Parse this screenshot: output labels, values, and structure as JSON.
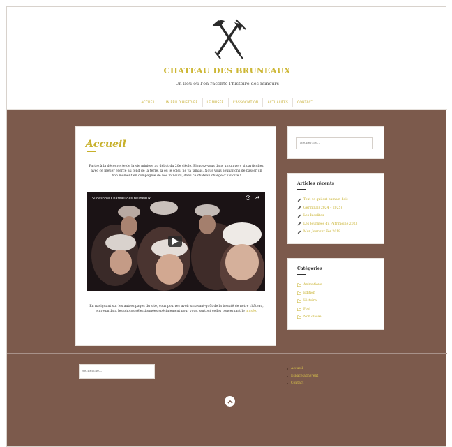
{
  "header": {
    "title": "CHATEAU DES BRUNEAUX",
    "tagline": "Un lieu où l'on raconte l'histoire des mineurs",
    "logo_icon": "crossed-shovel-pickaxe-icon"
  },
  "nav": {
    "items": [
      {
        "label": "ACCUEIL"
      },
      {
        "label": "UN PEU D'HISTOIRE"
      },
      {
        "label": "LE MUSÉE"
      },
      {
        "label": "L'ASSOCIATION"
      },
      {
        "label": "ACTUALITÉS"
      },
      {
        "label": "CONTACT"
      }
    ]
  },
  "main": {
    "page_title": "Accueil",
    "intro": "Partez à la découverte de la vie minière au début du 20e siècle. Plongez-vous dans un univers si particulier, avec ce métier exercé au fond de la terre, là où le soleil ne va jamais. Nous vous souhaitons de passer un bon moment en compagnie de nos mineurs, dans ce château chargé d'histoire !",
    "video_title": "Slideshow Château des Bruneaux",
    "outro_text": "En naviguant sur les autres pages du site, vous pourrez avoir un avant-goût de la beauté de notre château, en regardant les photos sélectionnées spécialement pour vous, surtout celles concernant le ",
    "outro_link": "musée",
    "outro_end": "."
  },
  "sidebar": {
    "search_placeholder": "Recherche…",
    "recent_title": "Articles récents",
    "recent_items": [
      {
        "label": "Tout ce qui est humain doit"
      },
      {
        "label": "Germinal (2024 – 2025)"
      },
      {
        "label": "Les Insolites"
      },
      {
        "label": "Les Journées du Patrimoine 2023"
      },
      {
        "label": "Mon Jour sur Fer 2018"
      }
    ],
    "categories_title": "Catégories",
    "categories": [
      {
        "label": "Animations"
      },
      {
        "label": "Edition"
      },
      {
        "label": "Histoire"
      },
      {
        "label": "Pool"
      },
      {
        "label": "Non classé"
      }
    ]
  },
  "footer": {
    "search_placeholder": "Recherche…",
    "links": [
      {
        "label": "Accueil"
      },
      {
        "label": "Espace adhérent"
      },
      {
        "label": "Contact"
      }
    ],
    "back_to_top_icon": "chevron-up-icon"
  },
  "colors": {
    "background": "#7c5a4c",
    "accent": "#c7b02a",
    "card": "#ffffff"
  }
}
